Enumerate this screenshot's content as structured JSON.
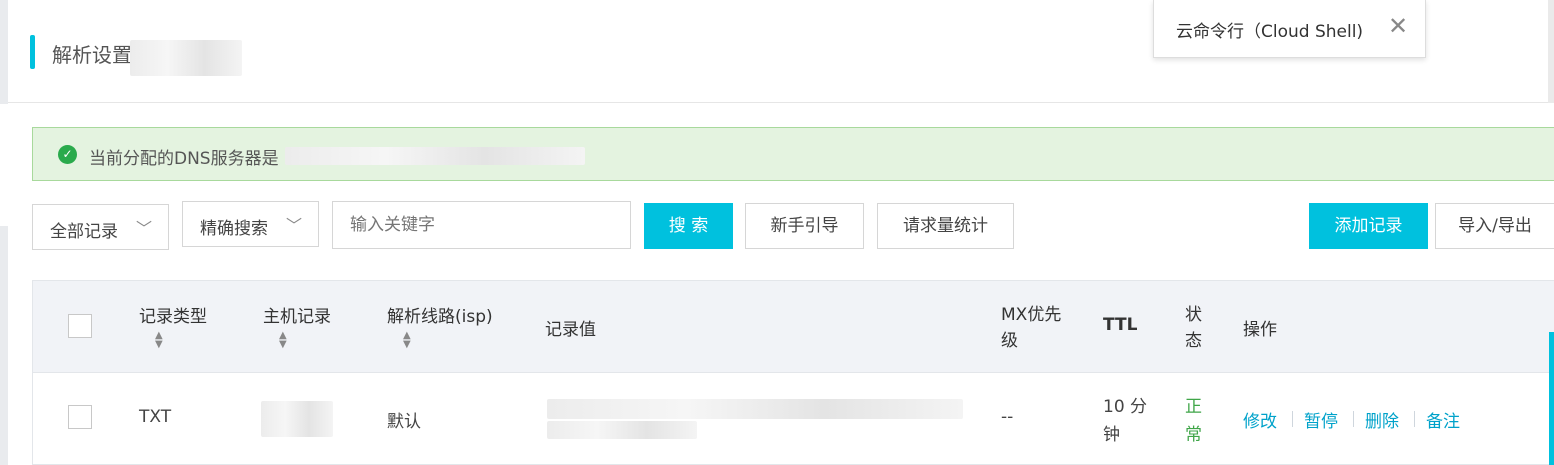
{
  "header": {
    "title": "解析设置"
  },
  "cloud_shell": {
    "label": "云命令行（Cloud Shell)",
    "close_icon": "✕"
  },
  "alert": {
    "text": "当前分配的DNS服务器是"
  },
  "toolbar": {
    "record_filter": "全部记录",
    "search_mode": "精确搜索",
    "keyword_placeholder": "输入关键字",
    "search_label": "搜 索",
    "guide_label": "新手引导",
    "stats_label": "请求量统计",
    "add_label": "添加记录",
    "import_export_label": "导入/导出"
  },
  "table": {
    "columns": {
      "type": "记录类型",
      "host": "主机记录",
      "line": "解析线路(isp)",
      "value": "记录值",
      "mx": "MX优先级",
      "ttl": "TTL",
      "status": "状态",
      "actions": "操作"
    },
    "rows": [
      {
        "type": "TXT",
        "line": "默认",
        "mx": "--",
        "ttl": "10 分钟",
        "status": "正常",
        "actions": {
          "edit": "修改",
          "pause": "暂停",
          "delete": "删除",
          "note": "备注"
        }
      }
    ]
  },
  "colors": {
    "accent": "#00c1de",
    "success": "#2aaa4c",
    "link": "#00a2ca"
  }
}
